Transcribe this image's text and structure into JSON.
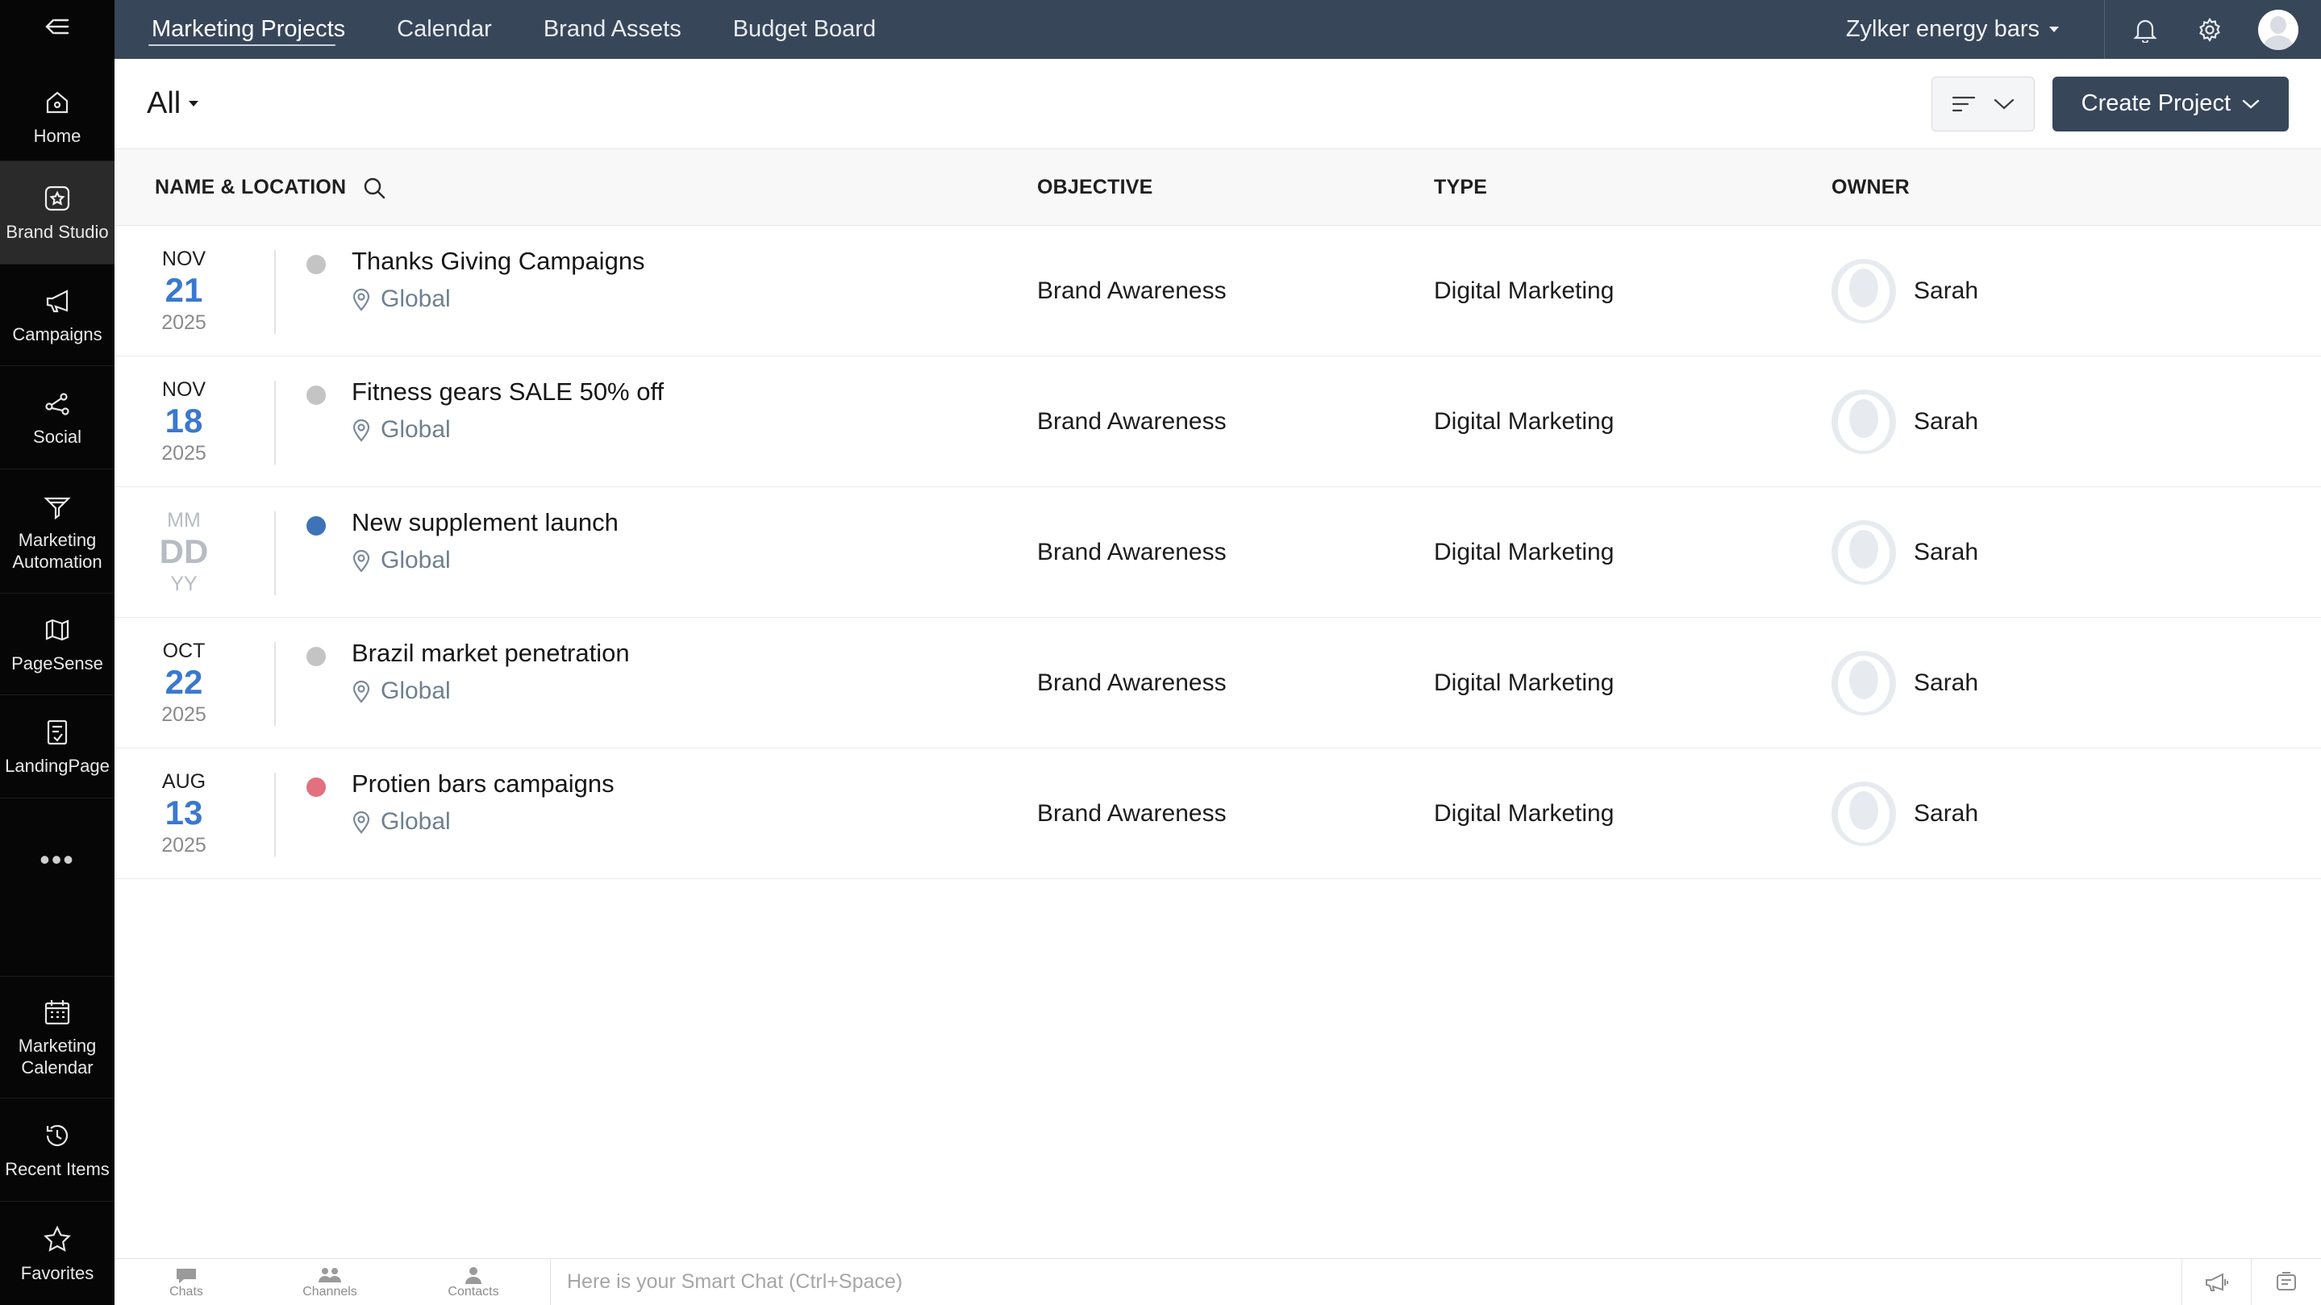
{
  "sidebar": {
    "items": [
      {
        "label": "Home",
        "icon": "home-icon"
      },
      {
        "label": "Brand Studio",
        "icon": "brand-studio-icon",
        "active": true
      },
      {
        "label": "Campaigns",
        "icon": "megaphone-icon"
      },
      {
        "label": "Social",
        "icon": "share-nodes-icon"
      },
      {
        "label": "Marketing Automation",
        "icon": "funnel-icon"
      },
      {
        "label": "PageSense",
        "icon": "pagesense-icon"
      },
      {
        "label": "LandingPage",
        "icon": "landing-page-icon"
      },
      {
        "label": "Marketing Calendar",
        "icon": "calendar-icon"
      },
      {
        "label": "Recent Items",
        "icon": "history-icon"
      },
      {
        "label": "Favorites",
        "icon": "star-icon"
      }
    ],
    "more": "•••"
  },
  "topnav": {
    "tabs": [
      "Marketing Projects",
      "Calendar",
      "Brand Assets",
      "Budget Board"
    ],
    "org": "Zylker energy bars"
  },
  "toolbar": {
    "view": "All",
    "create_label": "Create Project"
  },
  "table": {
    "columns": {
      "name": "NAME & LOCATION",
      "objective": "OBJECTIVE",
      "type": "TYPE",
      "owner": "OWNER"
    },
    "rows": [
      {
        "mon": "NOV",
        "day": "21",
        "yr": "2025",
        "name": "Thanks Giving Campaigns",
        "location": "Global",
        "objective": "Brand Awareness",
        "type": "Digital Marketing",
        "owner": "Sarah",
        "status_color": "#c4c4c4"
      },
      {
        "mon": "NOV",
        "day": "18",
        "yr": "2025",
        "name": "Fitness gears SALE 50% off",
        "location": "Global",
        "objective": "Brand Awareness",
        "type": "Digital Marketing",
        "owner": "Sarah",
        "status_color": "#c4c4c4"
      },
      {
        "mon": "MM",
        "day": "DD",
        "yr": "YY",
        "name": "New supplement launch",
        "location": "Global",
        "objective": "Brand Awareness",
        "type": "Digital Marketing",
        "owner": "Sarah",
        "status_color": "#3f73b8"
      },
      {
        "mon": "OCT",
        "day": "22",
        "yr": "2025",
        "name": "Brazil market penetration",
        "location": "Global",
        "objective": "Brand Awareness",
        "type": "Digital Marketing",
        "owner": "Sarah",
        "status_color": "#c4c4c4"
      },
      {
        "mon": "AUG",
        "day": "13",
        "yr": "2025",
        "name": "Protien bars campaigns",
        "location": "Global",
        "objective": "Brand Awareness",
        "type": "Digital Marketing",
        "owner": "Sarah",
        "status_color": "#e2707f"
      }
    ]
  },
  "chatbar": {
    "tabs": [
      "Chats",
      "Channels",
      "Contacts"
    ],
    "placeholder": "Here is your Smart Chat (Ctrl+Space)"
  },
  "colors": {
    "topbar": "#38465a",
    "sidebar": "#060606",
    "date_accent": "#3a78d0"
  }
}
